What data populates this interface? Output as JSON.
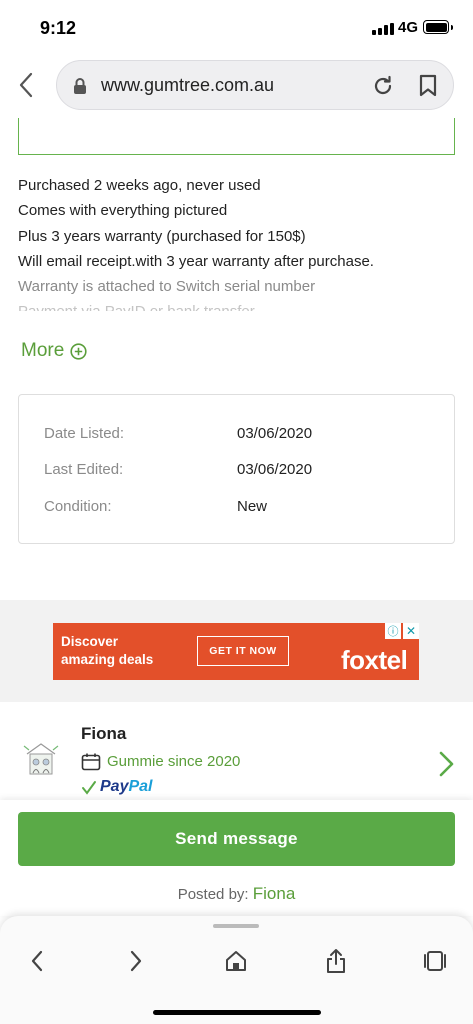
{
  "status_bar": {
    "time": "9:12",
    "network": "4G"
  },
  "browser": {
    "url": "www.gumtree.com.au"
  },
  "description": {
    "lines": [
      "Purchased 2 weeks ago, never used",
      "Comes with everything pictured",
      "Plus 3 years warranty (purchased for 150$)",
      "Will email receipt.with 3 year warranty after purchase.",
      "Warranty is attached to Switch serial number",
      "Payment via PayID or bank transfer"
    ],
    "more_label": "More"
  },
  "details": {
    "rows": [
      {
        "label": "Date Listed:",
        "value": "03/06/2020"
      },
      {
        "label": "Last Edited:",
        "value": "03/06/2020"
      },
      {
        "label": "Condition:",
        "value": "New"
      }
    ]
  },
  "ad": {
    "line1": "Discover",
    "line2": "amazing deals",
    "cta": "GET IT NOW",
    "brand": "foxtel",
    "color": "#e3502a"
  },
  "seller": {
    "name": "Fiona",
    "since": "Gummie since 2020",
    "paypal_part1": "Pay",
    "paypal_part2": "Pal"
  },
  "actions": {
    "send_label": "Send message",
    "posted_by_label": "Posted by:",
    "posted_by_name": "Fiona"
  },
  "colors": {
    "accent": "#5aaa47",
    "link": "#5a9e3a"
  }
}
